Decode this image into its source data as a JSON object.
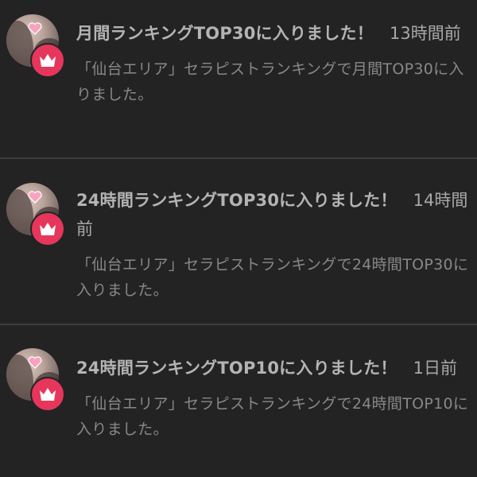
{
  "notifications": [
    {
      "title": "月間ランキングTOP30に入りました！",
      "time": "13時間前",
      "body": "「仙台エリア」セラピストランキングで月間TOP30に入りました。"
    },
    {
      "title": "24時間ランキングTOP30に入りました！",
      "time": "14時間前",
      "body": "「仙台エリア」セラピストランキングで24時間TOP30に入りました。"
    },
    {
      "title": "24時間ランキングTOP10に入りました！",
      "time": "1日前",
      "body": "「仙台エリア」セラピストランキングで24時間TOP10に入りました。"
    }
  ],
  "colors": {
    "background": "#232323",
    "badge": "#e6365c",
    "heart": "#f7a3c0",
    "title": "#b4b4b4",
    "body": "#888888"
  },
  "icons": {
    "avatar": "profile-photo",
    "heart": "heart-icon",
    "badge": "crown-icon"
  }
}
